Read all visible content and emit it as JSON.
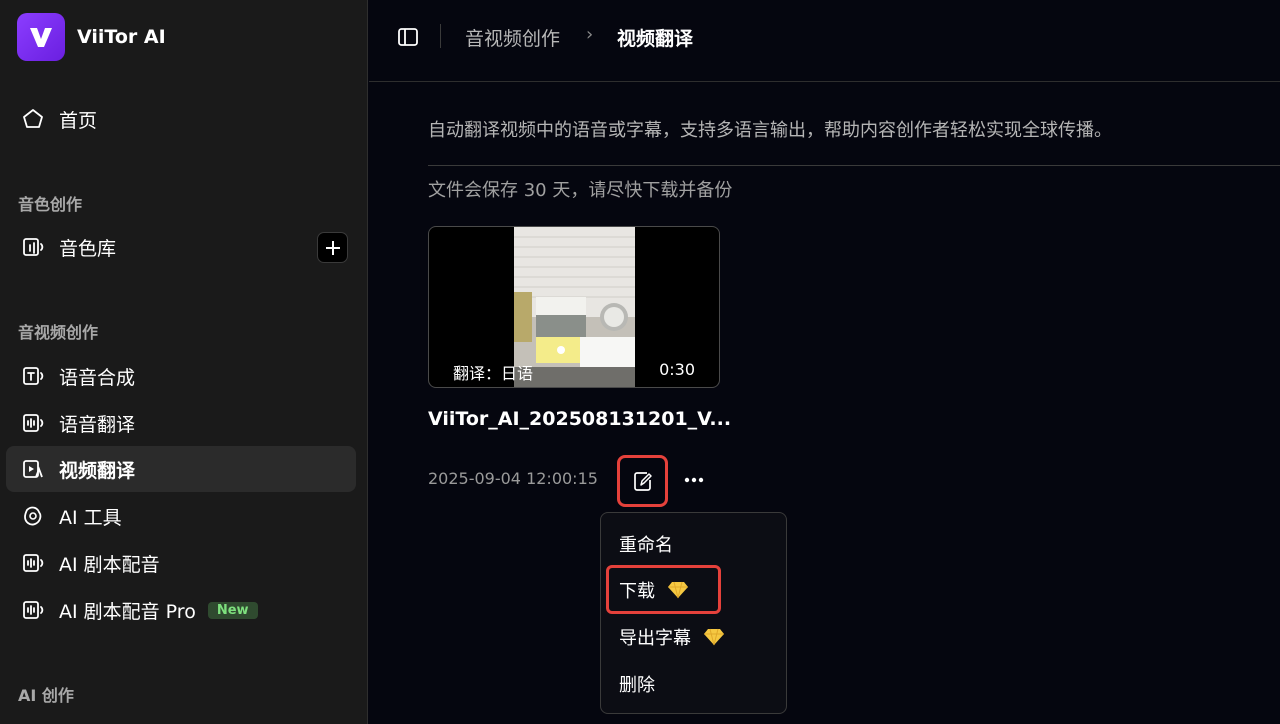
{
  "app": {
    "name": "ViiTor AI",
    "logo_letter": "V"
  },
  "sidebar": {
    "home": "首页",
    "sections": [
      {
        "label": "音色创作",
        "items": [
          "音色库"
        ]
      },
      {
        "label": "音视频创作",
        "items": [
          "语音合成",
          "语音翻译",
          "视频翻译",
          "AI 工具",
          "AI 剧本配音",
          "AI 剧本配音 Pro"
        ]
      },
      {
        "label": "AI 创作",
        "items": []
      }
    ],
    "active_item": "视频翻译",
    "new_badge": "New"
  },
  "header": {
    "breadcrumb": [
      "音视频创作",
      "视频翻译"
    ],
    "separator": "›"
  },
  "main": {
    "description": "自动翻译视频中的语音或字幕，支持多语言输出，帮助内容创作者轻松实现全球传播。",
    "notice": "文件会保存 30 天，请尽快下载并备份",
    "card": {
      "translate_label": "翻译：",
      "language": "日语",
      "duration": "0:30",
      "title": "ViiTor_AI_202508131201_V...",
      "date": "2025-09-04 12:00:15"
    },
    "context_menu": [
      "重命名",
      "下载",
      "导出字幕",
      "删除"
    ]
  },
  "colors": {
    "accent": "#7b2ff7",
    "highlight": "#e5413b",
    "new_badge_text": "#7ee07e",
    "gem": "#f5c842"
  }
}
